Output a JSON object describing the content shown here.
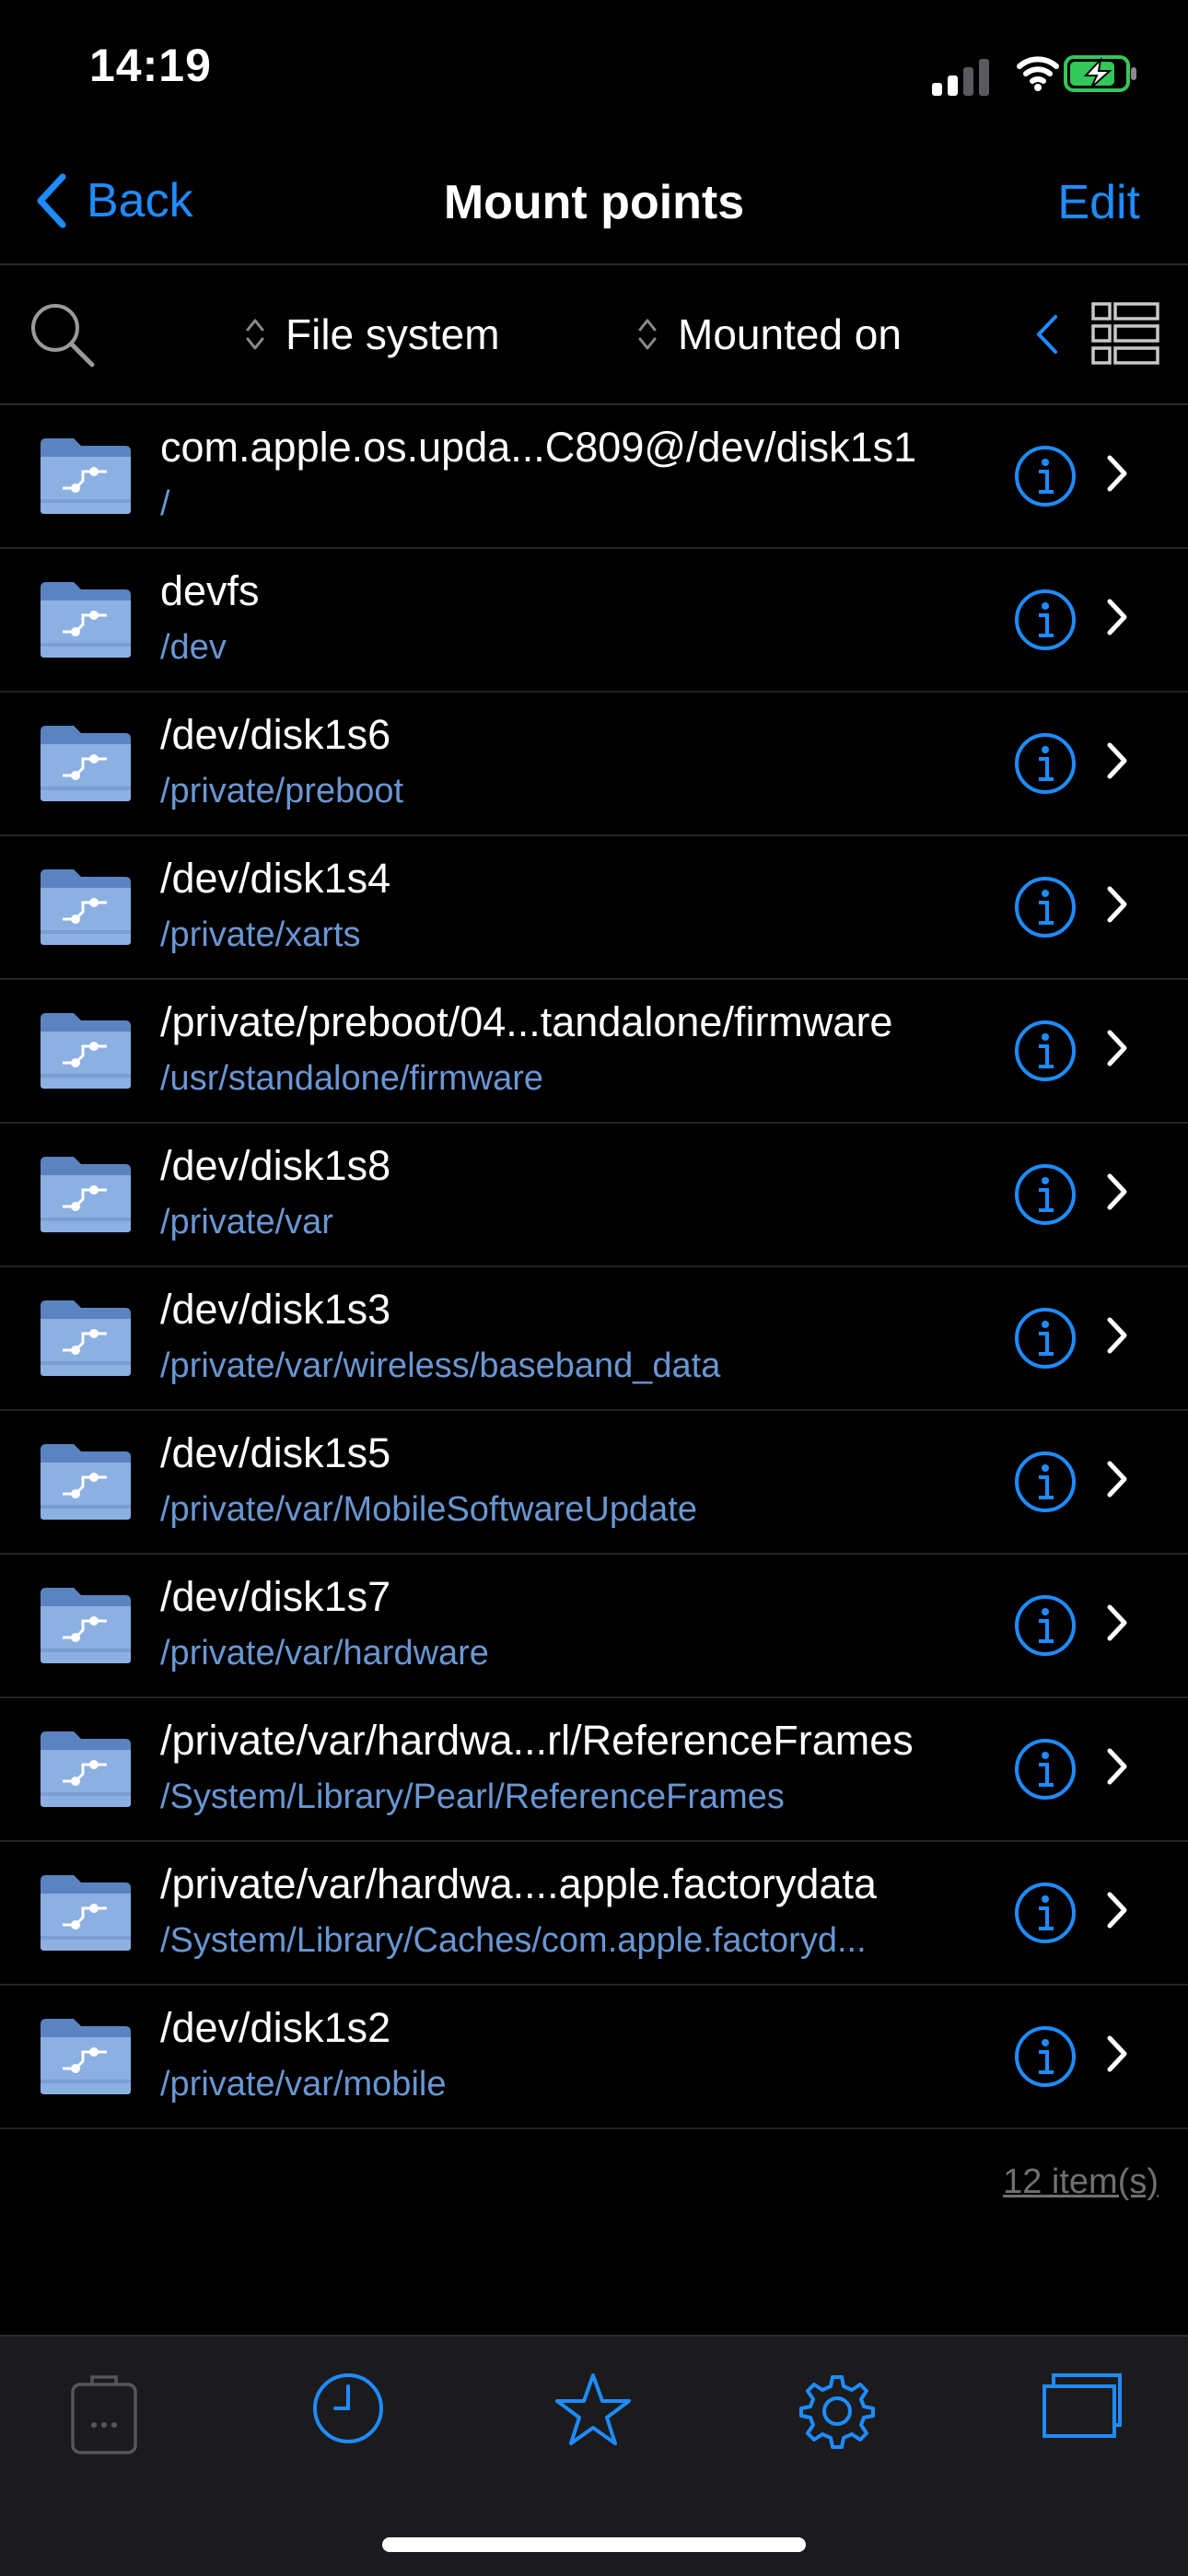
{
  "status_bar": {
    "time": "14:19"
  },
  "nav": {
    "back_label": "Back",
    "title": "Mount points",
    "edit_label": "Edit"
  },
  "toolbar": {
    "sort_file_system": "File system",
    "sort_mounted_on": "Mounted on"
  },
  "items": [
    {
      "title": "com.apple.os.upda...C809@/dev/disk1s1",
      "path": "/"
    },
    {
      "title": "devfs",
      "path": "/dev"
    },
    {
      "title": "/dev/disk1s6",
      "path": "/private/preboot"
    },
    {
      "title": "/dev/disk1s4",
      "path": "/private/xarts"
    },
    {
      "title": "/private/preboot/04...tandalone/firmware",
      "path": "/usr/standalone/firmware"
    },
    {
      "title": "/dev/disk1s8",
      "path": "/private/var"
    },
    {
      "title": "/dev/disk1s3",
      "path": "/private/var/wireless/baseband_data"
    },
    {
      "title": "/dev/disk1s5",
      "path": "/private/var/MobileSoftwareUpdate"
    },
    {
      "title": "/dev/disk1s7",
      "path": "/private/var/hardware"
    },
    {
      "title": "/private/var/hardwa...rl/ReferenceFrames",
      "path": "/System/Library/Pearl/ReferenceFrames"
    },
    {
      "title": "/private/var/hardwa....apple.factorydata",
      "path": "/System/Library/Caches/com.apple.factoryd..."
    },
    {
      "title": "/dev/disk1s2",
      "path": "/private/var/mobile"
    }
  ],
  "footer": {
    "item_count": "12 item(s)"
  },
  "tabbar": {
    "tabs": [
      {
        "icon": "clipboard-icon",
        "active": false
      },
      {
        "icon": "clock-icon",
        "active": true
      },
      {
        "icon": "star-icon",
        "active": true
      },
      {
        "icon": "gear-icon",
        "active": true
      },
      {
        "icon": "windows-icon",
        "active": true
      }
    ]
  },
  "colors": {
    "accent": "#1e8cff",
    "subtitle": "#6a96d2",
    "background": "#000000",
    "tabbar": "#1b1b1d"
  }
}
